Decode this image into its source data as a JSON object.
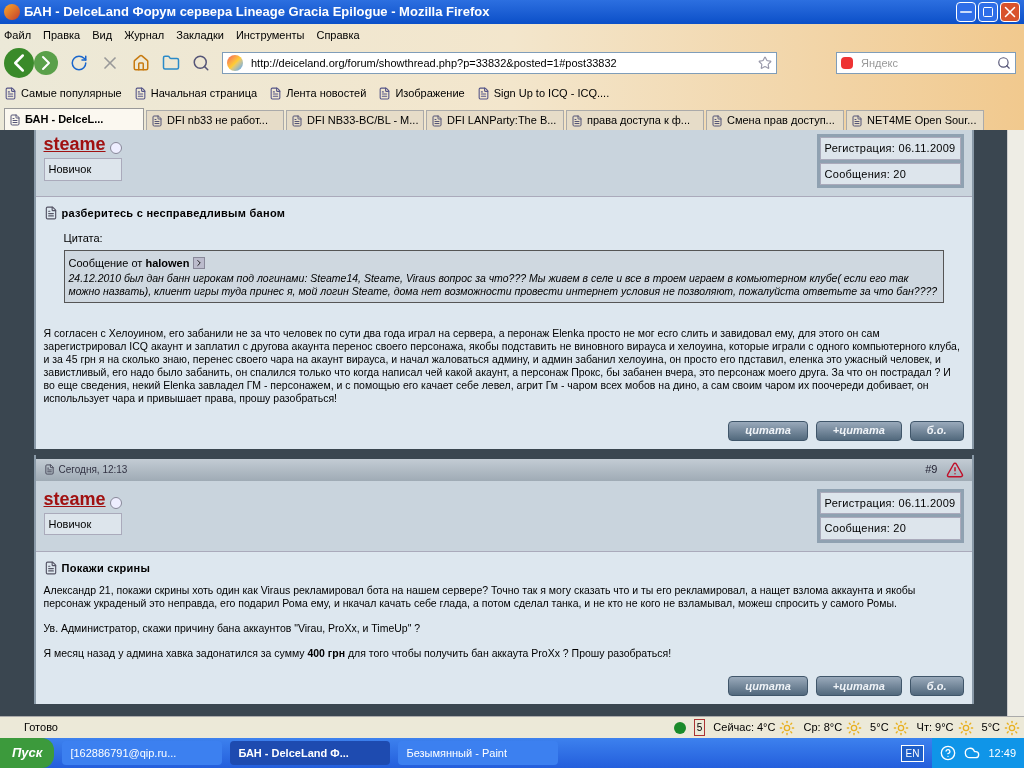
{
  "window": {
    "title": "БАН - DelceLand Форум сервера Lineage Gracia Epilogue - Mozilla Firefox"
  },
  "menu": [
    "Файл",
    "Правка",
    "Вид",
    "Журнал",
    "Закладки",
    "Инструменты",
    "Справка"
  ],
  "nav": {
    "url": "http://deiceland.org/forum/showthread.php?p=33832&posted=1#post33832",
    "search_placeholder": "Яндекс"
  },
  "bookmarks": [
    "Самые популярные",
    "Начальная страница",
    "Лента новостей",
    "Изображение",
    "Sign Up to ICQ - ICQ...."
  ],
  "tabs": [
    {
      "label": "БАН - DeIceL...",
      "selected": true
    },
    {
      "label": "DFI nb33 не работ...",
      "selected": false
    },
    {
      "label": "DFI NB33-BC/BL - M...",
      "selected": false
    },
    {
      "label": "DFI LANParty:The B...",
      "selected": false
    },
    {
      "label": "права доступа к ф...",
      "selected": false
    },
    {
      "label": "Смена прав доступ...",
      "selected": false
    },
    {
      "label": "NET4ME Open Sour...",
      "selected": false
    }
  ],
  "posts": [
    {
      "author": "steame",
      "rank": "Новичок",
      "registration": "Регистрация: 06.11.2009",
      "messages": "Сообщения: 20",
      "title": "разберитесь с несправедливым баном",
      "quote": {
        "label": "Цитата:",
        "from": "Сообщение от",
        "author": "halowen",
        "text": "24.12.2010 был дан банн игрокам под логинами: Steame14, Steame, Viraus вопрос за что??? Мы живем в селе и все в троем играем в комьютерном клубе( если его так можно назвать), клиент игры туда принес я, мой логин Steame, дома нет возможности провести интернет условия не позволяют, пожалуйста ответьте за что бан????"
      },
      "paragraphs": [
        "Я согласен с Хелоуином, его забанили не за что человек по сути два года играл на сервера, а перонаж Elenka просто не мог есго слить и завидовал ему, для этого он сам зарегистрировал ICQ акаунт и заплатил с другова акаунта перенос своего персонажа, якобы подставить не виновного вирауса и хелоуина, которые играли с одного компьютерного клуба, и за 45 грн я на сколько знаю, перенес своего чара на акаунт вирауса, и начал жаловаться админу, и админ забанил хелоуина, он просто его пдставил, еленка это ужасный человек, и завистливый, его надо было забанить, он спалился только что когда написал чей какой акаунт, а персонаж Прокс, бы забанен вчера, это персонаж моего друга. За что он пострадал ? И во еще сведения, некий Elenka завладел ГМ - персонажем, и с помощью его качает себе левел, агрит Гм - чаром всех мобов на дино, а сам своим чаром их поочереди добивает, он испольльзует чара и привышает права, прошу разобраться!"
      ],
      "buttons": [
        "цитата",
        "+цитата",
        "б.о."
      ]
    },
    {
      "date": "Сегодня, 12:13",
      "number": "#9",
      "author": "steame",
      "rank": "Новичок",
      "registration": "Регистрация: 06.11.2009",
      "messages": "Сообщения: 20",
      "title": "Покажи скрины",
      "paragraphs": [
        "Александр 21, покажи скрины хоть один как Viraus рекламировал бота на нашем сервере? Точно так я могу сказать что и ты его рекламировал, а нащет взлома аккаунта и якобы персонаж украденый это неправда, его подарил Рома ему, и нкачал качать себе глада, а потом сделал танка, и не кто не кого не взламывал, можеш спросить у самого Ромы.",
        "Ув. Администратор, скажи причину бана аккаунтов \"Virau, ProXx, и TimeUp\" ?",
        "Я месяц назад у админа хавка задонатился за сумму **400 грн** для того чтобы получить бан аккаута ProXx ? Прошу разобраться!"
      ],
      "buttons": [
        "цитата",
        "+цитата",
        "б.о."
      ]
    }
  ],
  "status": {
    "text": "Готово",
    "weather": [
      "Сейчас: 4°C",
      "Ср: 8°C",
      "5°C",
      "Чт: 9°C",
      "5°C"
    ],
    "calendar_day": "5"
  },
  "taskbar": {
    "start": "Пуск",
    "tasks": [
      {
        "label": "[162886791@qip.ru...",
        "selected": false
      },
      {
        "label": "БАН - DelceLand Ф...",
        "selected": true
      },
      {
        "label": "Безымянный - Paint",
        "selected": false
      }
    ],
    "language": "EN",
    "clock": "12:49"
  }
}
